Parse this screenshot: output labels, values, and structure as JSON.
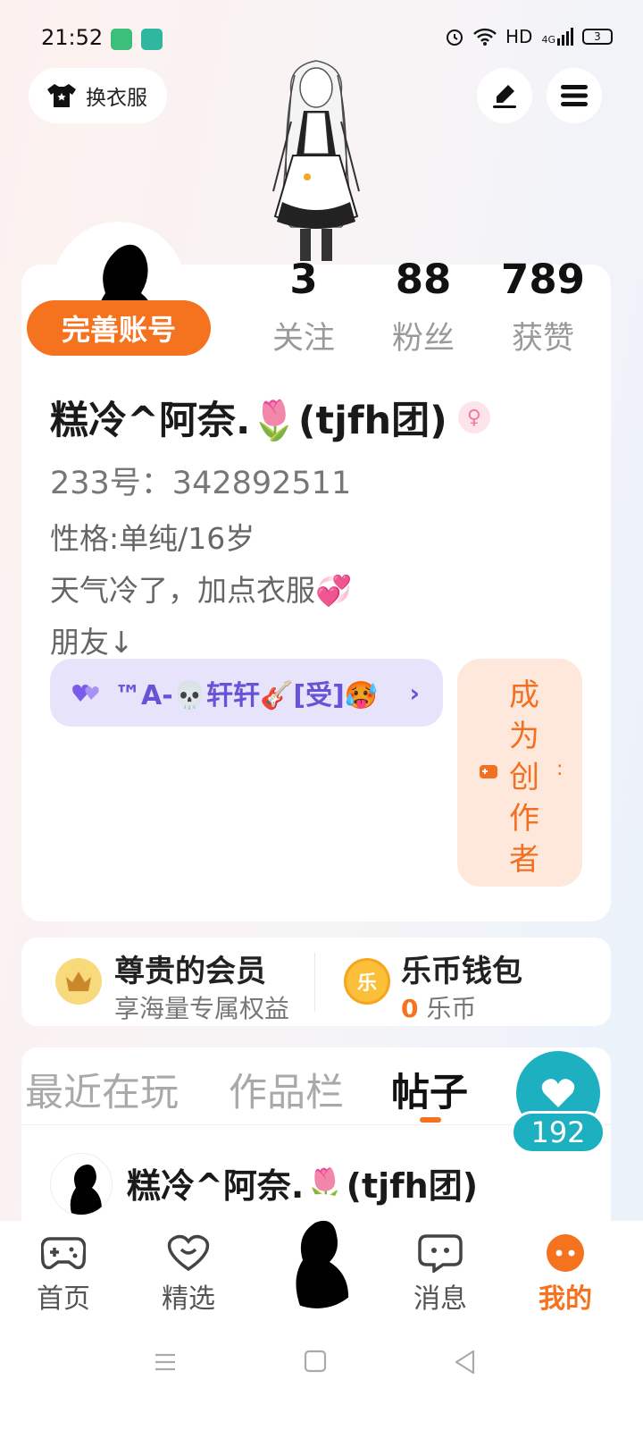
{
  "status_bar": {
    "time": "21:52",
    "hd_label": "HD",
    "net_label": "4G",
    "battery_level": "3"
  },
  "top_bar": {
    "dress_label": "换衣服",
    "icons": [
      "shirt-icon",
      "pen-icon",
      "menu-icon"
    ]
  },
  "profile": {
    "complete_label": "完善账号",
    "stats": [
      {
        "value": "3",
        "label": "关注"
      },
      {
        "value": "88",
        "label": "粉丝"
      },
      {
        "value": "789",
        "label": "获赞"
      }
    ],
    "nickname": "糕冷^阿奈.🌷(tjfh团)",
    "gender_symbol": "♀",
    "uid": "233号：342892511",
    "bio_lines": [
      "性格:单纯/16岁",
      "天气冷了，加点衣服💞",
      "朋友↓"
    ],
    "cp_tag": "™A-💀轩轩🎸[受]🥵",
    "creator_label": "成为创作者",
    "creator_chars": [
      "成",
      "为",
      "创",
      "作",
      "者"
    ]
  },
  "wallet": {
    "member_title": "尊贵的会员",
    "member_sub": "享海量专属权益",
    "coin_title": "乐币钱包",
    "coin_amount": "0",
    "coin_unit": "乐币",
    "coin_icon_text": "乐"
  },
  "tabs": {
    "items": [
      "最近在玩",
      "作品栏",
      "帖子"
    ],
    "active": "帖子",
    "likes_count": "192"
  },
  "post": {
    "author": "糕冷^阿奈.🌷(tjfh团)"
  },
  "bottom_nav": {
    "items": [
      {
        "label": "首页",
        "icon": "gamepad-icon"
      },
      {
        "label": "精选",
        "icon": "heart-chat-icon"
      },
      {
        "label": "消息",
        "icon": "message-icon"
      },
      {
        "label": "我的",
        "icon": "profile-dots-icon"
      }
    ],
    "active": "我的"
  },
  "colors": {
    "accent": "#f5731f",
    "purple_tag": "#6a52d6",
    "teal": "#1cb0c1"
  }
}
